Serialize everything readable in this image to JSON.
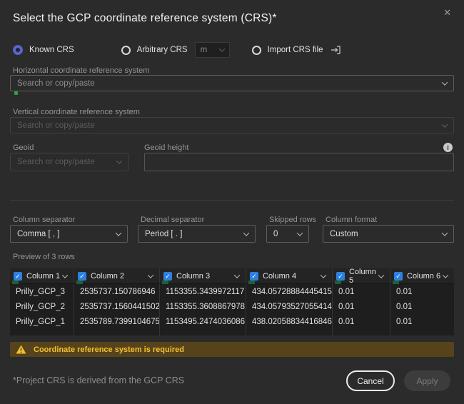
{
  "dialog": {
    "title": "Select the GCP coordinate reference system (CRS)*"
  },
  "icons": {
    "close": "✕",
    "check": "✓",
    "info": "i",
    "warning_exclaim": "!"
  },
  "crs_type": {
    "options": [
      {
        "label": "Known CRS",
        "selected": true
      },
      {
        "label": "Arbitrary CRS",
        "selected": false,
        "unit": "m"
      },
      {
        "label": "Import CRS file",
        "selected": false
      }
    ]
  },
  "horizontal_crs": {
    "label": "Horizontal coordinate reference system",
    "placeholder": "Search or copy/paste"
  },
  "vertical_crs": {
    "label": "Vertical coordinate reference system",
    "placeholder": "Search or copy/paste"
  },
  "geoid": {
    "label": "Geoid",
    "placeholder": "Search or copy/paste"
  },
  "geoid_height": {
    "label": "Geoid height",
    "value": ""
  },
  "separators": {
    "column_separator": {
      "label": "Column separator",
      "value": "Comma [ , ]"
    },
    "decimal_separator": {
      "label": "Decimal separator",
      "value": "Period [ . ]"
    },
    "skipped_rows": {
      "label": "Skipped rows",
      "value": "0"
    },
    "column_format": {
      "label": "Column format",
      "value": "Custom"
    }
  },
  "preview": {
    "label": "Preview of 3 rows",
    "columns": [
      "Column 1",
      "Column 2",
      "Column 3",
      "Column 4",
      "Column 5",
      "Column 6"
    ],
    "rows": [
      [
        "Prilly_GCP_3",
        "2535737.150786946",
        "1153355.3439972117",
        "434.05728884445415",
        "0.01",
        "0.01"
      ],
      [
        "Prilly_GCP_2",
        "2535737.1560441502",
        "1153355.3608867978",
        "434.05793527055414",
        "0.01",
        "0.01"
      ],
      [
        "Prilly_GCP_1",
        "2535789.7399104675",
        "1153495.2474036086",
        "438.02058834416846",
        "0.01",
        "0.01"
      ]
    ]
  },
  "warning": {
    "text": "Coordinate reference system is required"
  },
  "footer": {
    "note": "*Project CRS is derived from the GCP CRS",
    "cancel_label": "Cancel",
    "apply_label": "Apply"
  },
  "colors": {
    "background": "#2b2b2b",
    "accent_checkbox_blue": "#2e80e0",
    "radio_indigo": "#5864c8",
    "warning_text": "#f1c232",
    "warning_background": "#57431b",
    "green_marker": "#1c603a"
  }
}
